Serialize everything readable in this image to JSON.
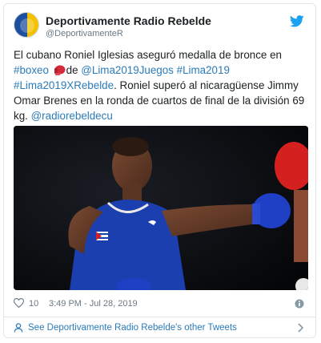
{
  "account": {
    "display_name": "Deportivamente Radio Rebelde",
    "handle": "@DeportivamenteR"
  },
  "tweet": {
    "parts": [
      {
        "t": "El cubano Roniel Iglesias aseguró medalla de bronce en ",
        "link": false
      },
      {
        "t": "#boxeo",
        "link": true
      },
      {
        "t": " ",
        "link": false
      },
      {
        "t": "[glove]",
        "emoji": "boxing-glove-icon"
      },
      {
        "t": "de ",
        "link": false
      },
      {
        "t": "@Lima2019Juegos",
        "link": true
      },
      {
        "t": " ",
        "link": false
      },
      {
        "t": "#Lima2019",
        "link": true
      },
      {
        "t": " ",
        "link": false
      },
      {
        "t": "#Lima2019XRebelde",
        "link": true
      },
      {
        "t": ". Roniel superó al nicaragüense Jimmy Omar Brenes en la ronda de cuartos de final de la división 69 kg. ",
        "link": false
      },
      {
        "t": "@radiorebeldecu",
        "link": true
      }
    ]
  },
  "meta": {
    "likes": "10",
    "timestamp": "3:49 PM - Jul 28, 2019"
  },
  "footer": {
    "see_more": "See Deportivamente Radio Rebelde's other Tweets"
  },
  "colors": {
    "link": "#2b7bb9",
    "text": "#1c2022",
    "muted": "#697882",
    "twitter_blue": "#1da1f2"
  },
  "icons": [
    "twitter-bird-icon",
    "heart-icon",
    "info-icon",
    "person-icon",
    "chevron-right-icon",
    "boxing-glove-icon"
  ]
}
